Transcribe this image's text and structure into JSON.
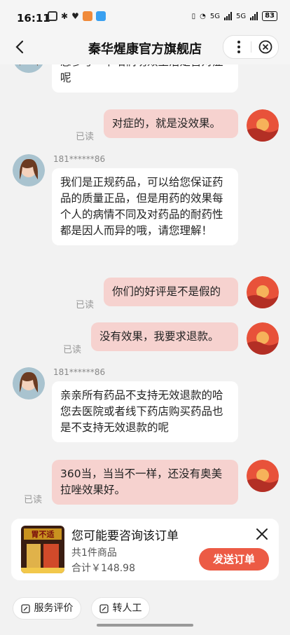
{
  "status_bar": {
    "time": "16:11",
    "network": "5G",
    "battery": "83"
  },
  "header": {
    "title": "秦华煋康官方旗舰店"
  },
  "messages": {
    "m1": {
      "text": "您参考一下咱们功效主治是否对症呢"
    },
    "m2": {
      "text": "对症的，就是没效果。",
      "read": "已读"
    },
    "m3": {
      "nickname": "181******86",
      "text": "我们是正规药品，可以给您保证药品的质量正品，但是用药的效果每个人的病情不同及对药品的耐药性都是因人而异的哦，请您理解！"
    },
    "m4": {
      "text": "你们的好评是不是假的",
      "read": "已读"
    },
    "m5": {
      "text": "没有效果，我要求退款。",
      "read": "已读"
    },
    "m6": {
      "nickname": "181******86",
      "text": "亲亲所有药品不支持无效退款的哈 您去医院或者线下药店购买药品也是不支持无效退款的呢"
    },
    "m7": {
      "text": "360当，当当不一样，还没有奥美拉唑效果好。",
      "read": "已读"
    }
  },
  "order_card": {
    "title": "您可能要咨询该订单",
    "count": "共1件商品",
    "total": "合计￥148.98",
    "send_label": "发送订单",
    "thumb_text": "胃不适"
  },
  "bottom": {
    "rate_label": "服务评价",
    "human_label": "转人工"
  },
  "colors": {
    "accent": "#ec5b45",
    "bubble_right": "#f6d2cf"
  }
}
